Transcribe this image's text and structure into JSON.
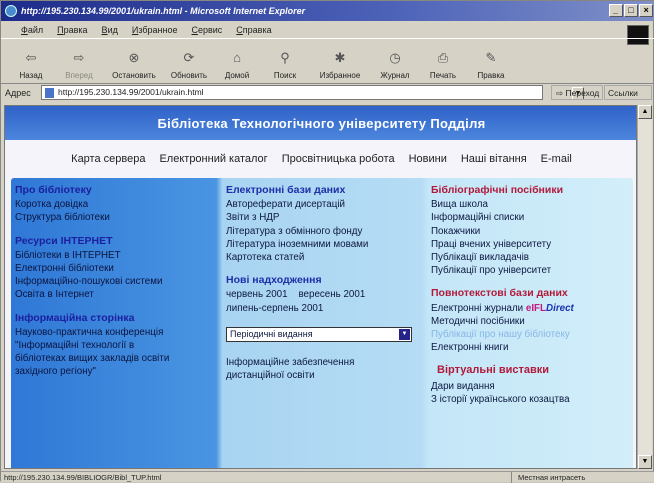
{
  "window": {
    "title": "http://195.230.134.99/2001/ukrain.html - Microsoft Internet Explorer",
    "buttons": [
      "_",
      "□",
      "×"
    ]
  },
  "menu": [
    "Файл",
    "Правка",
    "Вид",
    "Избранное",
    "Сервис",
    "Справка"
  ],
  "toolbar": [
    {
      "label": "Назад",
      "icon": "back-arrow-icon",
      "glyph": "⇦",
      "enabled": true
    },
    {
      "label": "Вперед",
      "icon": "forward-arrow-icon",
      "glyph": "⇨",
      "enabled": false
    },
    {
      "label": "Остановить",
      "icon": "stop-icon",
      "glyph": "⊗",
      "enabled": true
    },
    {
      "label": "Обновить",
      "icon": "refresh-icon",
      "glyph": "⟳",
      "enabled": true
    },
    {
      "label": "Домой",
      "icon": "home-icon",
      "glyph": "⌂",
      "enabled": true
    },
    {
      "label": "Поиск",
      "icon": "search-icon",
      "glyph": "⚲",
      "enabled": true
    },
    {
      "label": "Избранное",
      "icon": "favorites-icon",
      "glyph": "✱",
      "enabled": true
    },
    {
      "label": "Журнал",
      "icon": "history-icon",
      "glyph": "◷",
      "enabled": true
    },
    {
      "label": "Печать",
      "icon": "print-icon",
      "glyph": "⎙",
      "enabled": true
    },
    {
      "label": "Правка",
      "icon": "edit-icon",
      "glyph": "✎",
      "enabled": true
    }
  ],
  "address": {
    "label": "Адрес",
    "url": "http://195.230.134.99/2001/ukrain.html",
    "go": "Переход",
    "links": "Ссылки"
  },
  "page": {
    "title": "Бібліотека Технологічного університету Подділя",
    "nav": [
      "Карта сервера",
      "Електронний каталог",
      "Просвітницька робота",
      "Новини",
      "Наші вітання",
      "E-mail"
    ],
    "col1": {
      "section1": {
        "heading": "Про бібліотеку",
        "items": [
          "Коротка довідка",
          "Структура бібліотеки"
        ]
      },
      "section2": {
        "heading": "Ресурси ІНТЕРНЕТ",
        "items": [
          "Бібліотеки в ІНТЕРНЕТ",
          "Електронні бібліотеки",
          "Інформаційно-пошукові системи",
          "Освіта в Інтернет"
        ]
      },
      "section3": {
        "heading": "Інформаційна сторінка",
        "items": [
          "Науково-практична конференція",
          "\"Інформаційні технології в",
          "бібліотеках вищих закладів освіти",
          "західного регіону\""
        ]
      }
    },
    "col2": {
      "section1": {
        "heading": "Електронні бази даних",
        "items": [
          "Автореферати дисертацій",
          "Звіти з НДР",
          "Література з обмінного фонду",
          "Література іноземними мовами",
          "Картотека статей"
        ]
      },
      "section2": {
        "heading": "Нові надходження",
        "items": [
          "червень 2001    вересень 2001",
          "липень-серпень 2001"
        ]
      },
      "select_value": "Періодичні видання",
      "footer": [
        "Інформаційне забезпечення",
        "дистанційної освіти"
      ]
    },
    "col3": {
      "section1": {
        "heading": "Бібліографічні посібники",
        "items": [
          "Вища школа",
          "Інформаційні списки",
          "Покажчики",
          "Праці вчених університету",
          "Публікації викладачів",
          "Публікації про університет"
        ]
      },
      "section2": {
        "heading": "Повнотекстові бази даних",
        "items": [
          "Електронні журнали",
          "Методичні посібники",
          "Публікації про нашу бібліотеку",
          "Електронні книги"
        ],
        "elfl_a": "eIFL",
        "elfl_b": "Direct"
      },
      "section3": {
        "heading": "Віртуальні виставки",
        "items": [
          "Дари видання",
          "З історії українського козацтва"
        ]
      }
    }
  },
  "status": {
    "url": "http://195.230.134.99/BIBLIOGR/Bibl_TUP.html",
    "zone": "Местная интрасеть"
  }
}
